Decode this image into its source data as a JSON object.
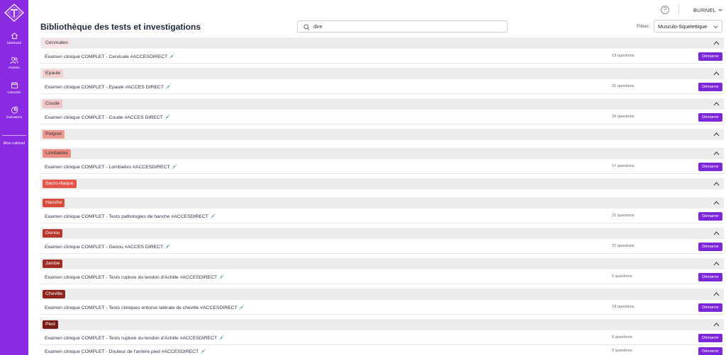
{
  "sidebar": {
    "nav": [
      {
        "label": "Dashboard",
        "icon": "home-icon"
      },
      {
        "label": "Patients",
        "icon": "users-icon"
      },
      {
        "label": "Calendrier",
        "icon": "calendar-icon"
      },
      {
        "label": "Évaluations",
        "icon": "pie-chart-icon"
      }
    ],
    "cabinet_label": "Mon cabinet"
  },
  "topbar": {
    "help_symbol": "?",
    "user_name": "BURNEL"
  },
  "page": {
    "title": "Bibliothèque des tests et investigations",
    "search_value": "dire",
    "filter_label": "Filtrer:",
    "filter_value": "Musculo-Squelettique"
  },
  "start_label": "Démarrer",
  "emoji": "💉",
  "sections": [
    {
      "name": "Cervicales",
      "tag_bg": "#f6e2e2",
      "tag_fg": "#333333",
      "items": [
        {
          "title": "Examen clinique COMPLET - Cervicale #ACCESDIRECT",
          "count": "13 questions"
        }
      ]
    },
    {
      "name": "Epaule",
      "tag_bg": "#f3cfcf",
      "tag_fg": "#333333",
      "items": [
        {
          "title": "Examen clinique COMPLET - Epaule #ACCES DIRECT",
          "count": "31 questions"
        }
      ]
    },
    {
      "name": "Coude",
      "tag_bg": "#f0c4c4",
      "tag_fg": "#333333",
      "items": [
        {
          "title": "Examen clinique COMPLET - Coude #ACCES DIRECT",
          "count": "26 questions"
        }
      ]
    },
    {
      "name": "Poignet",
      "tag_bg": "#ec9a92",
      "tag_fg": "#333333",
      "items": []
    },
    {
      "name": "Lombaires",
      "tag_bg": "#ea8a82",
      "tag_fg": "#333333",
      "items": [
        {
          "title": "Examen clinique COMPLET - Lombaires #ACCESDIRECT",
          "count": "17 questions"
        }
      ]
    },
    {
      "name": "Sacro-iliaque",
      "tag_bg": "#e5544a",
      "tag_fg": "#ffffff",
      "items": []
    },
    {
      "name": "Hanche",
      "tag_bg": "#d94a3c",
      "tag_fg": "#ffffff",
      "items": [
        {
          "title": "Examen clinique COMPLET - Tests pathologies de hanche #ACCESDIRECT",
          "count": "21 questions"
        }
      ]
    },
    {
      "name": "Genou",
      "tag_bg": "#b8372d",
      "tag_fg": "#ffffff",
      "items": [
        {
          "title": "Examen clinique COMPLET - Genou #ACCES DIRECT",
          "count": "37 questions"
        }
      ]
    },
    {
      "name": "Jambe",
      "tag_bg": "#9c2c24",
      "tag_fg": "#ffffff",
      "items": [
        {
          "title": "Examen clinique COMPLET - Tests rupture du tendon d'Achille #ACCESDIRECT",
          "count": "5 questions"
        }
      ]
    },
    {
      "name": "Cheville",
      "tag_bg": "#8a241c",
      "tag_fg": "#ffffff",
      "items": [
        {
          "title": "Examen clinique COMPLET - Tests cliniques entorse latérale de cheville #ACCESDIRECT",
          "count": "19 questions"
        }
      ]
    },
    {
      "name": "Pied",
      "tag_bg": "#7a1c16",
      "tag_fg": "#ffffff",
      "items": [
        {
          "title": "Examen clinique COMPLET - Tests rupture du tendon d'Achille #ACCESDIRECT",
          "count": "5 questions"
        },
        {
          "title": "Examen clinique COMPLET - Douleur de l'arrière pied #ACCESDIRECT",
          "count": "9 questions"
        }
      ]
    }
  ],
  "colors": {
    "sidebar": "#8a2be2",
    "accent": "#7b26d8",
    "section_bar": "#ececec"
  }
}
